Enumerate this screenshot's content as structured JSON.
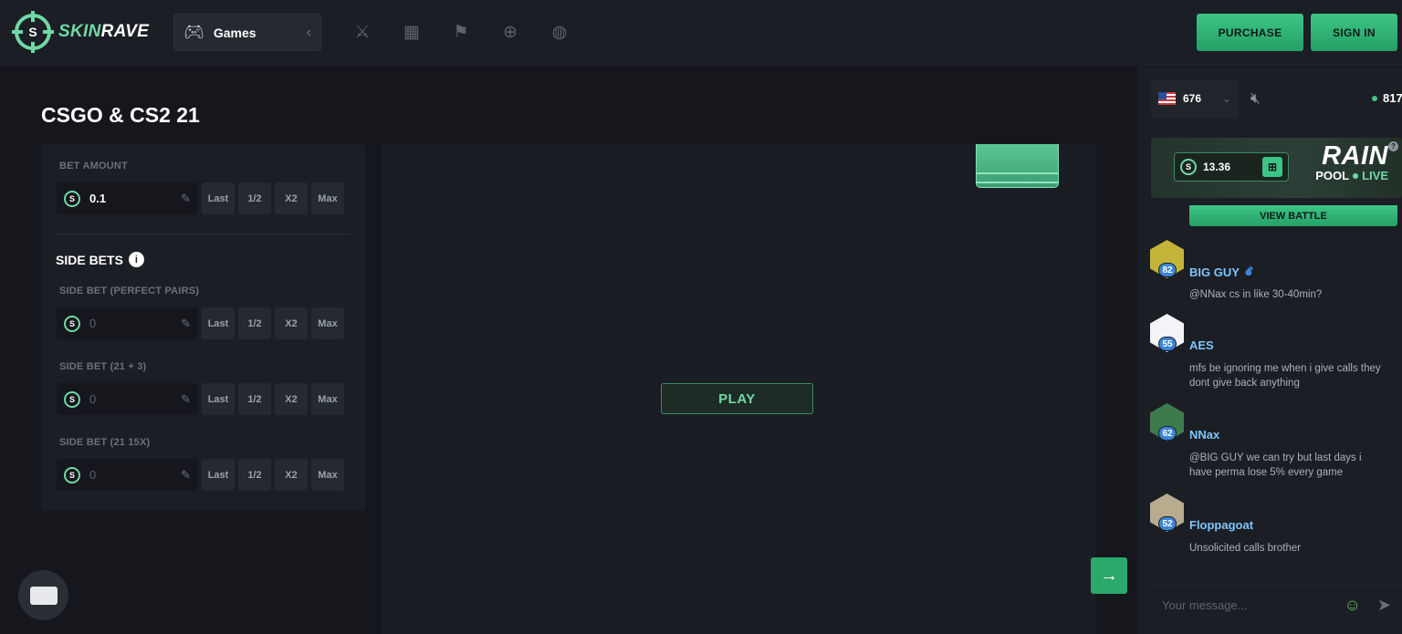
{
  "header": {
    "logo_skin": "SKIN",
    "logo_rave": "RAVE",
    "games_label": "Games",
    "nav_icons": [
      "swords-icon",
      "gift-icon",
      "flag-icon",
      "add-user-icon",
      "globe-icon"
    ],
    "purchase_label": "PURCHASE",
    "signin_label": "SIGN IN"
  },
  "page": {
    "title": "CSGO & CS2 21"
  },
  "bet": {
    "amount_label": "BET AMOUNT",
    "amount_value": "0.1",
    "buttons": [
      "Last",
      "1/2",
      "X2",
      "Max"
    ],
    "side_bets_title": "SIDE BETS",
    "side_bets": [
      {
        "label": "SIDE BET (PERFECT PAIRS)",
        "value": "0"
      },
      {
        "label": "SIDE BET (21 + 3)",
        "value": "0"
      },
      {
        "label": "SIDE BET (21 15X)",
        "value": "0"
      }
    ]
  },
  "game": {
    "play_label": "PLAY"
  },
  "sidebar": {
    "lang_count": "676",
    "online_count": "817",
    "rain_amount": "13.36",
    "rain_title": "RAIN",
    "rain_pool": "POOL",
    "rain_live": "LIVE",
    "view_battle": "VIEW BATTLE",
    "messages": [
      {
        "user": "BIG GUY",
        "level": "82",
        "text": "@NNax cs in like 30-40min?",
        "avatar_color": "#c4b43a"
      },
      {
        "user": "AES",
        "level": "55",
        "text": "mfs be ignoring me when i give calls they dont give back anything",
        "avatar_color": "#f2f4f7"
      },
      {
        "user": "NNax",
        "level": "62",
        "text": "@BIG GUY we can try but last days i have perma lose 5% every game",
        "avatar_color": "#3d7a4c"
      },
      {
        "user": "Floppagoat",
        "level": "52",
        "text": "Unsolicited calls brother",
        "avatar_color": "#b8ab8e"
      }
    ],
    "chat_placeholder": "Your message..."
  },
  "colors": {
    "accent": "#3dc585",
    "bg": "#15171c",
    "panel": "#1b1e24",
    "username": "#7cc5ff"
  }
}
